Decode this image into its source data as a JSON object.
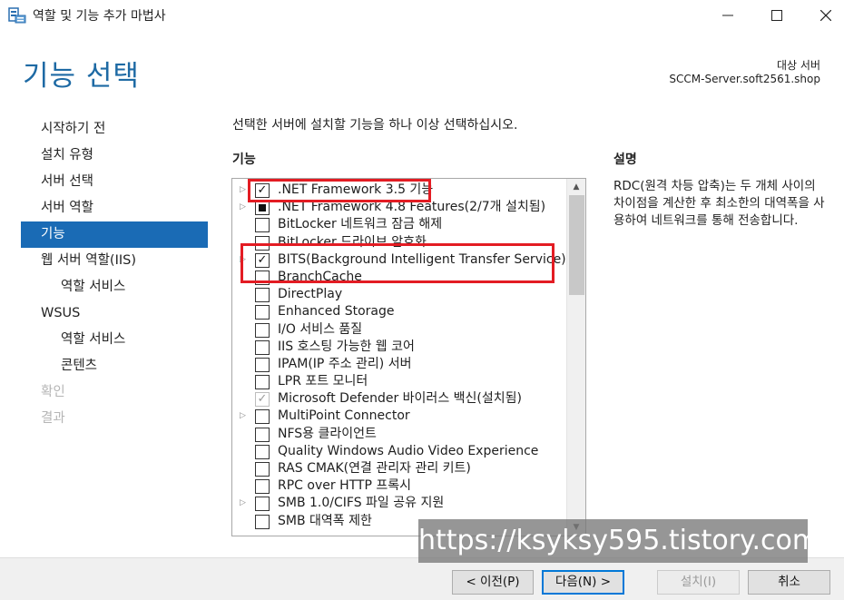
{
  "window": {
    "title": "역할 및 기능 추가 마법사",
    "icon": "server-manager-icon",
    "controls": {
      "minimize": "—",
      "maximize": "☐",
      "close": "✕"
    }
  },
  "header": {
    "page_title": "기능 선택",
    "destination_label": "대상 서버",
    "destination_server": "SCCM-Server.soft2561.shop"
  },
  "nav": {
    "items": [
      {
        "label": "시작하기 전",
        "state": "normal",
        "level": 0
      },
      {
        "label": "설치 유형",
        "state": "normal",
        "level": 0
      },
      {
        "label": "서버 선택",
        "state": "normal",
        "level": 0
      },
      {
        "label": "서버 역할",
        "state": "normal",
        "level": 0
      },
      {
        "label": "기능",
        "state": "active",
        "level": 0
      },
      {
        "label": "웹 서버 역할(IIS)",
        "state": "normal",
        "level": 0
      },
      {
        "label": "역할 서비스",
        "state": "normal",
        "level": 1
      },
      {
        "label": "WSUS",
        "state": "normal",
        "level": 0
      },
      {
        "label": "역할 서비스",
        "state": "normal",
        "level": 1
      },
      {
        "label": "콘텐츠",
        "state": "normal",
        "level": 1
      },
      {
        "label": "확인",
        "state": "disabled",
        "level": 0
      },
      {
        "label": "결과",
        "state": "disabled",
        "level": 0
      }
    ]
  },
  "main": {
    "instruction": "선택한 서버에 설치할 기능을 하나 이상 선택하십시오.",
    "features_header": "기능",
    "features": [
      {
        "label": ".NET Framework 3.5 기능",
        "checked": "checked",
        "expandable": true
      },
      {
        "label": ".NET Framework 4.8 Features(2/7개 설치됨)",
        "checked": "partial",
        "expandable": true
      },
      {
        "label": "BitLocker 네트워크 잠금 해제",
        "checked": "unchecked",
        "expandable": false
      },
      {
        "label": "BitLocker 드라이브 암호화",
        "checked": "unchecked",
        "expandable": false
      },
      {
        "label": "BITS(Background Intelligent Transfer Service)",
        "checked": "checked",
        "expandable": true
      },
      {
        "label": "BranchCache",
        "checked": "unchecked",
        "expandable": false
      },
      {
        "label": "DirectPlay",
        "checked": "unchecked",
        "expandable": false
      },
      {
        "label": "Enhanced Storage",
        "checked": "unchecked",
        "expandable": false
      },
      {
        "label": "I/O 서비스 품질",
        "checked": "unchecked",
        "expandable": false
      },
      {
        "label": "IIS 호스팅 가능한 웹 코어",
        "checked": "unchecked",
        "expandable": false
      },
      {
        "label": "IPAM(IP 주소 관리) 서버",
        "checked": "unchecked",
        "expandable": false
      },
      {
        "label": "LPR 포트 모니터",
        "checked": "unchecked",
        "expandable": false
      },
      {
        "label": "Microsoft Defender 바이러스 백신(설치됨)",
        "checked": "installed",
        "expandable": false
      },
      {
        "label": "MultiPoint Connector",
        "checked": "unchecked",
        "expandable": true
      },
      {
        "label": "NFS용 클라이언트",
        "checked": "unchecked",
        "expandable": false
      },
      {
        "label": "Quality Windows Audio Video Experience",
        "checked": "unchecked",
        "expandable": false
      },
      {
        "label": "RAS CMAK(연결 관리자 관리 키트)",
        "checked": "unchecked",
        "expandable": false
      },
      {
        "label": "RPC over HTTP 프록시",
        "checked": "unchecked",
        "expandable": false
      },
      {
        "label": "SMB 1.0/CIFS 파일 공유 지원",
        "checked": "unchecked",
        "expandable": true
      },
      {
        "label": "SMB 대역폭 제한",
        "checked": "unchecked",
        "expandable": false
      }
    ],
    "description_header": "설명",
    "description_text": "RDC(원격 차등 압축)는 두 개체 사이의 차이점을 계산한 후 최소한의 대역폭을 사용하여 네트워크를 통해 전송합니다."
  },
  "footer": {
    "prev_label": "< 이전(P)",
    "next_label": "다음(N) >",
    "install_label": "설치(I)",
    "cancel_label": "취소"
  },
  "watermark": "https://ksyksy595.tistory.com",
  "colors": {
    "title_blue": "#1e6aa4",
    "nav_active": "#1a6bb5",
    "highlight_red": "#e31c23"
  }
}
